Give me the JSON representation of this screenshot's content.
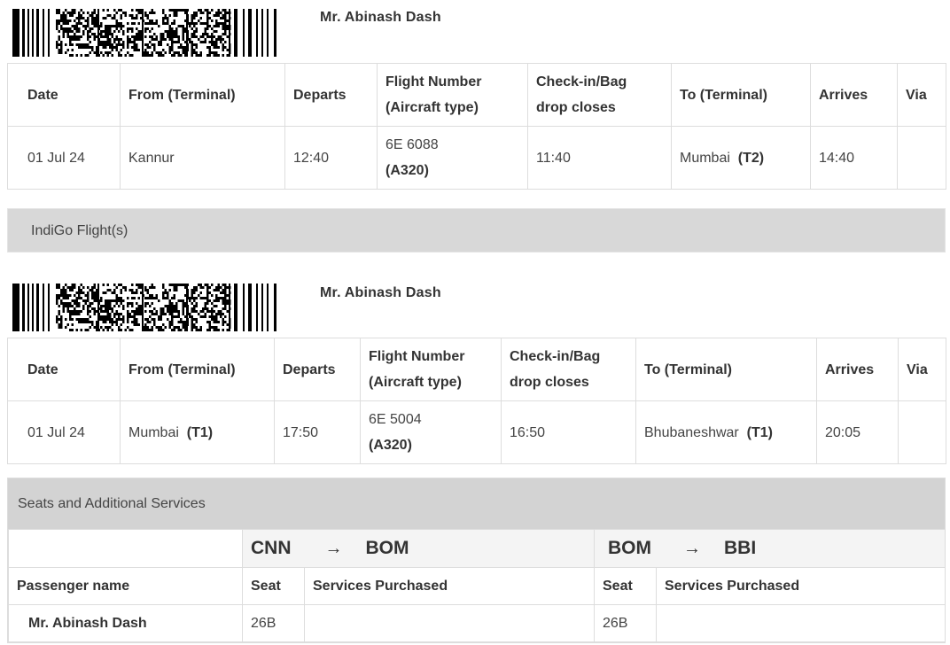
{
  "segments": [
    {
      "passenger": "Mr. Abinash Dash",
      "headers": [
        "Date",
        "From (Terminal)",
        "Departs",
        "Flight Number",
        "(Aircraft type)",
        "Check-in/Bag",
        "drop closes",
        "To (Terminal)",
        "Arrives",
        "Via"
      ],
      "date": "01 Jul 24",
      "from_city": "Kannur",
      "from_terminal": "",
      "departs": "12:40",
      "flight_number": "6E 6088",
      "aircraft": "(A320)",
      "checkin_closes": "11:40",
      "to_city": "Mumbai",
      "to_terminal": "(T2)",
      "arrives": "14:40",
      "via": ""
    },
    {
      "passenger": "Mr. Abinash Dash",
      "headers": [
        "Date",
        "From (Terminal)",
        "Departs",
        "Flight Number",
        "(Aircraft type)",
        "Check-in/Bag",
        "drop closes",
        "To (Terminal)",
        "Arrives",
        "Via"
      ],
      "date": "01 Jul 24",
      "from_city": "Mumbai",
      "from_terminal": "(T1)",
      "departs": "17:50",
      "flight_number": "6E 5004",
      "aircraft": "(A320)",
      "checkin_closes": "16:50",
      "to_city": "Bhubaneshwar",
      "to_terminal": "(T1)",
      "arrives": "20:05",
      "via": ""
    }
  ],
  "section_label": "IndiGo Flight(s)",
  "services": {
    "title": "Seats and Additional Services",
    "routes": [
      {
        "origin": "CNN",
        "arrow": "→",
        "destination": "BOM"
      },
      {
        "origin": "BOM",
        "arrow": "→",
        "destination": "BBI"
      }
    ],
    "headers": {
      "passenger": "Passenger name",
      "seat": "Seat",
      "services": "Services Purchased"
    },
    "rows": [
      {
        "passenger": "Mr. Abinash Dash",
        "seat_1": "26B",
        "services_1": "",
        "seat_2": "26B",
        "services_2": ""
      }
    ]
  }
}
